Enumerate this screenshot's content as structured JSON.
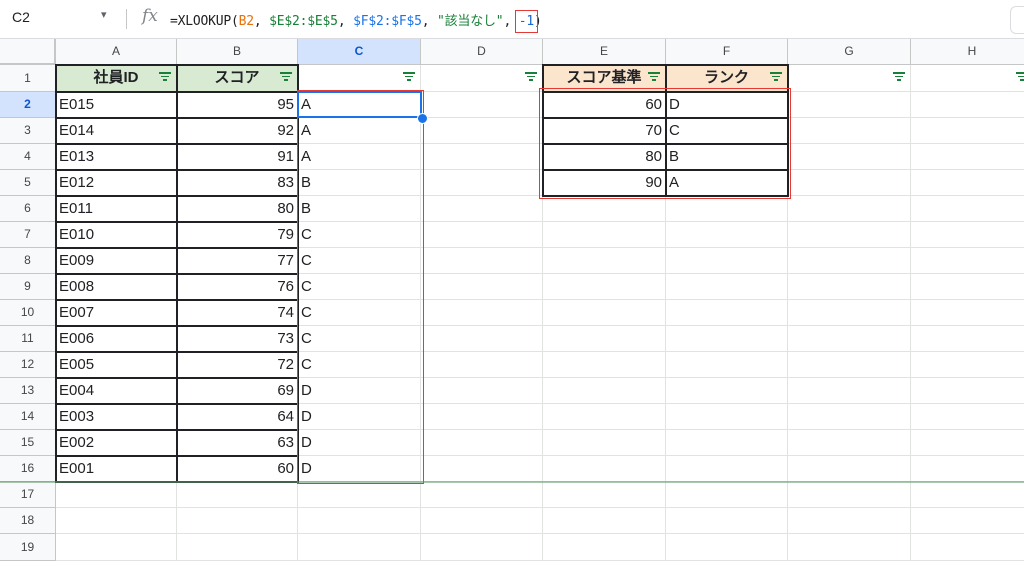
{
  "formula_bar": {
    "name_box": "C2",
    "name_box_caret": "▾",
    "fx": "fx",
    "formula": {
      "prefix": "=XLOOKUP(",
      "ref1": "B2",
      "sep1": ", ",
      "ref2": "$E$2:$E$5",
      "sep2": ", ",
      "ref3": "$F$2:$F$5",
      "sep3": ", ",
      "str": "\"該当なし\"",
      "sep4": ", ",
      "num": "-1",
      "suffix": ")"
    }
  },
  "columns": [
    "A",
    "B",
    "C",
    "D",
    "E",
    "F",
    "G",
    "H"
  ],
  "rows": [
    "1",
    "2",
    "3",
    "4",
    "5",
    "6",
    "7",
    "8",
    "9",
    "10",
    "11",
    "12",
    "13",
    "14",
    "15",
    "16",
    "17",
    "18",
    "19"
  ],
  "selected_cell": "C2",
  "table_headers": {
    "employee_id": "社員ID",
    "score": "スコア",
    "rank_result": "",
    "score_threshold": "スコア基準",
    "rank": "ランク"
  },
  "employees": [
    {
      "id": "E015",
      "score": "95",
      "rank": "A"
    },
    {
      "id": "E014",
      "score": "92",
      "rank": "A"
    },
    {
      "id": "E013",
      "score": "91",
      "rank": "A"
    },
    {
      "id": "E012",
      "score": "83",
      "rank": "B"
    },
    {
      "id": "E011",
      "score": "80",
      "rank": "B"
    },
    {
      "id": "E010",
      "score": "79",
      "rank": "C"
    },
    {
      "id": "E009",
      "score": "77",
      "rank": "C"
    },
    {
      "id": "E008",
      "score": "76",
      "rank": "C"
    },
    {
      "id": "E007",
      "score": "74",
      "rank": "C"
    },
    {
      "id": "E006",
      "score": "73",
      "rank": "C"
    },
    {
      "id": "E005",
      "score": "72",
      "rank": "C"
    },
    {
      "id": "E004",
      "score": "69",
      "rank": "D"
    },
    {
      "id": "E003",
      "score": "64",
      "rank": "D"
    },
    {
      "id": "E002",
      "score": "63",
      "rank": "D"
    },
    {
      "id": "E001",
      "score": "60",
      "rank": "D"
    }
  ],
  "rank_table": [
    {
      "threshold": "60",
      "rank": "D"
    },
    {
      "threshold": "70",
      "rank": "C"
    },
    {
      "threshold": "80",
      "rank": "B"
    },
    {
      "threshold": "90",
      "rank": "A"
    }
  ],
  "colors": {
    "header_green": "#d9ead3",
    "header_orange": "#fce5cd",
    "selection_blue": "#1a73e8",
    "highlight_red": "#e53935",
    "filter_icon": "#188038"
  }
}
